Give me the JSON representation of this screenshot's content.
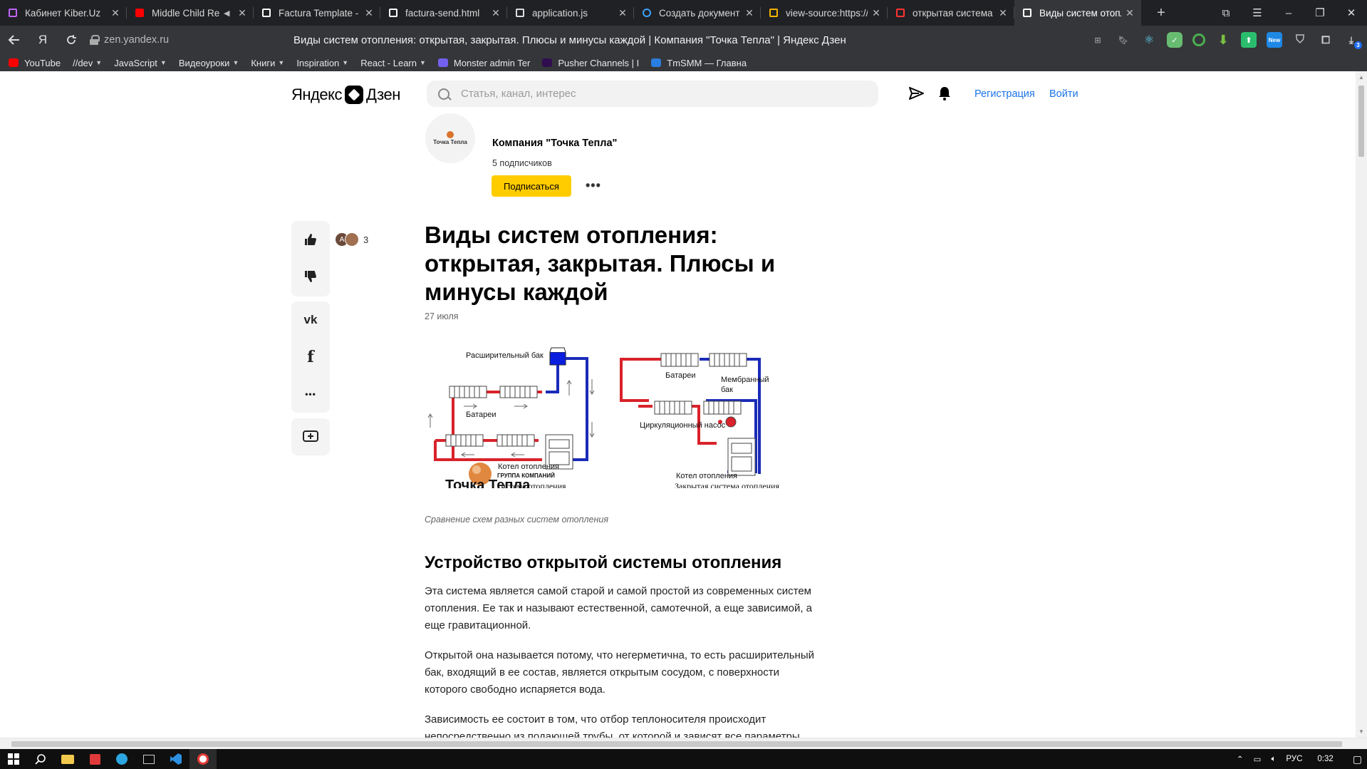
{
  "browser": {
    "tabs": [
      {
        "title": "Кабинет Kiber.Uz",
        "icon": "share-icon",
        "color": "#c064ff",
        "active": false
      },
      {
        "title": "Middle Child Re",
        "icon": "youtube-icon",
        "color": "#ff0000",
        "active": false,
        "sound": true
      },
      {
        "title": "Factura Template - S",
        "icon": "document-icon",
        "color": "#ffffff",
        "active": false
      },
      {
        "title": "factura-send.html",
        "icon": "document-icon",
        "color": "#ffffff",
        "active": false
      },
      {
        "title": "application.js",
        "icon": "js-file-icon",
        "color": "#dddddd",
        "active": false
      },
      {
        "title": "Создать документ |",
        "icon": "f-logo-icon",
        "color": "#3aa3ff",
        "active": false
      },
      {
        "title": "view-source:https://c",
        "icon": "grid-logo-icon",
        "color": "#f4b400",
        "active": false
      },
      {
        "title": "открытая система и",
        "icon": "yandex-icon",
        "color": "#ff3333",
        "active": false
      },
      {
        "title": "Виды систем отопл",
        "icon": "zen-icon",
        "color": "#ffffff",
        "active": true
      }
    ],
    "address": {
      "url": "zen.yandex.ru",
      "page_title": "Виды систем отопления: открытая, закрытая. Плюсы и минусы каждой | Компания \"Точка Тепла\" | Яндекс Дзен",
      "yandex_button": "Я"
    },
    "bookmarks": [
      {
        "label": "YouTube",
        "icon": "youtube-icon",
        "color": "#ff0000",
        "caret": false
      },
      {
        "label": "//dev",
        "caret": true
      },
      {
        "label": "JavaScript",
        "caret": true
      },
      {
        "label": "Видеоуроки",
        "caret": true
      },
      {
        "label": "Книги",
        "caret": true
      },
      {
        "label": "Inspiration",
        "caret": true
      },
      {
        "label": "React - Learn",
        "caret": true
      },
      {
        "label": "Monster admin Ter",
        "icon": "monster-icon",
        "color": "#7460ee",
        "caret": false
      },
      {
        "label": "Pusher Channels | I",
        "icon": "pusher-icon",
        "color": "#300d4f",
        "caret": false
      },
      {
        "label": "TmSMM — Главна",
        "icon": "tmsmm-icon",
        "color": "#2a7de1",
        "caret": false
      }
    ],
    "extension_badge": "3"
  },
  "header": {
    "logo_left": "Яндекс",
    "logo_right": "Дзен",
    "search_placeholder": "Статья, канал, интерес",
    "register": "Регистрация",
    "login": "Войти"
  },
  "channel": {
    "avatar_text": "Точка Тепла",
    "name": "Компания \"Точка Тепла\"",
    "subscribers": "5 подписчиков",
    "subscribe": "Подписаться",
    "more": "•••"
  },
  "reactions": {
    "avatar_letter": "A",
    "count": "3",
    "more": "•••",
    "vk": "vk"
  },
  "article": {
    "title": "Виды систем отопления: открытая, закрытая. Плюсы и минусы каждой",
    "date": "27 июля",
    "figure": {
      "left": {
        "expansion_tank": "Расширительный бак",
        "batteries": "Батареи",
        "boiler": "Котел отопления",
        "company_small": "ГРУППА КОМПАНИЙ",
        "company": "Точка Тепла",
        "caption_fragment": "система отопления"
      },
      "right": {
        "batteries": "Батареи",
        "membrane_tank_1": "Мембранный",
        "membrane_tank_2": "бак",
        "pump": "Циркуляционный насос",
        "boiler": "Котел отопления",
        "caption": "Закрытая система отопления"
      }
    },
    "caption": "Сравнение схем разных систем отопления",
    "h2": "Устройство открытой системы отопления",
    "p1": "Эта система является самой старой и  самой простой из современных систем отопления. Ее так и называют естественной, самотечной,  а еще зависимой, а еще гравитационной.",
    "p2": "Открытой она называется потому, что негерметична, то есть расширительный бак, входящий в ее состав, является открытым сосудом, с поверхности которого свободно испаряется вода.",
    "p3": "Зависимость ее состоит в том, что отбор теплоносителя происходит непосредственно из подающей трубы, от которой и зависят все параметры"
  },
  "taskbar": {
    "lang": "РУС",
    "time": "0:32"
  },
  "colors": {
    "accent_yellow": "#ffcc00",
    "link_blue": "#1a73e8",
    "hot_pipe": "#d9222a",
    "cold_pipe": "#1a2bb8"
  }
}
